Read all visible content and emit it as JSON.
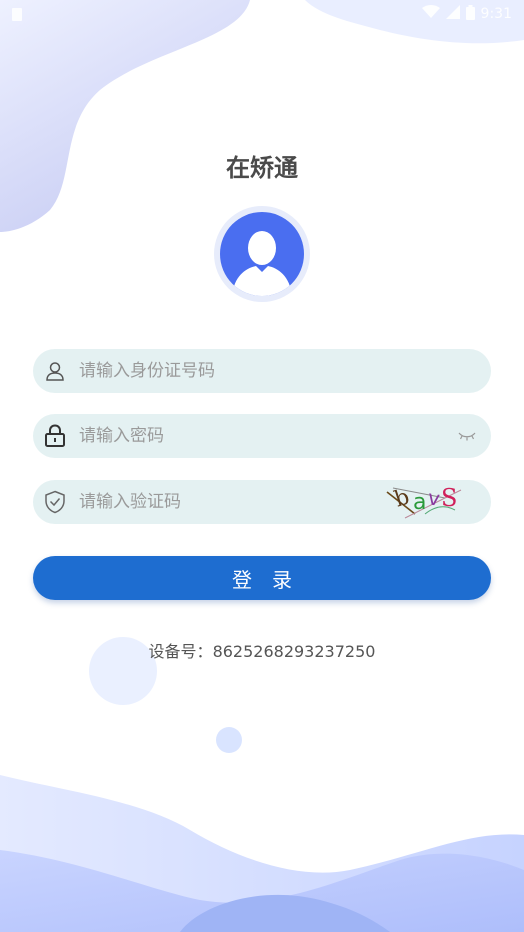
{
  "status_bar": {
    "time": "9:31"
  },
  "app": {
    "title": "在矫通"
  },
  "form": {
    "id_placeholder": "请输入身份证号码",
    "password_placeholder": "请输入密码",
    "captcha_placeholder": "请输入验证码",
    "captcha_text": "bavS"
  },
  "login_label": "登录",
  "device": {
    "label": "设备号：",
    "number": "8625268293237250"
  },
  "colors": {
    "accent": "#1e6dd0",
    "field_bg": "#e4f1f2",
    "avatar_blue": "#4a6ef0"
  },
  "icons": [
    "user-icon",
    "lock-icon",
    "shield-icon",
    "eye-closed-icon",
    "wifi-icon",
    "signal-icon",
    "battery-icon"
  ]
}
